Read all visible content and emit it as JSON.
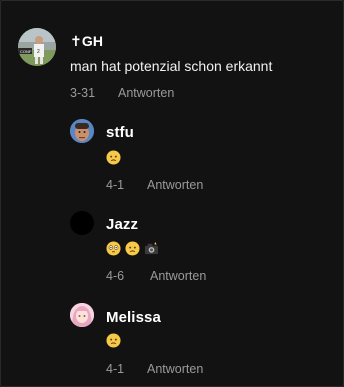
{
  "comments": {
    "main": {
      "username": "✝GH",
      "text": "man hat potenzial schon erkannt",
      "date": "3-31",
      "reply_label": "Antworten",
      "avatar_icon": "soccer-player-avatar"
    },
    "replies": [
      {
        "username": "stfu",
        "emojis": [
          "worried-face"
        ],
        "date": "4-1",
        "reply_label": "Antworten",
        "avatar_icon": "man-face-avatar"
      },
      {
        "username": "Jazz",
        "emojis": [
          "flushed-face",
          "worried-face",
          "camera-flash"
        ],
        "date": "4-6",
        "reply_label": "Antworten",
        "avatar_icon": "black-circle-avatar"
      },
      {
        "username": "Melissa",
        "emojis": [
          "worried-face"
        ],
        "date": "4-1",
        "reply_label": "Antworten",
        "avatar_icon": "anime-girl-avatar"
      }
    ]
  },
  "colors": {
    "background": "#121212",
    "text": "#ffffff",
    "meta": "#9a9a9a"
  }
}
